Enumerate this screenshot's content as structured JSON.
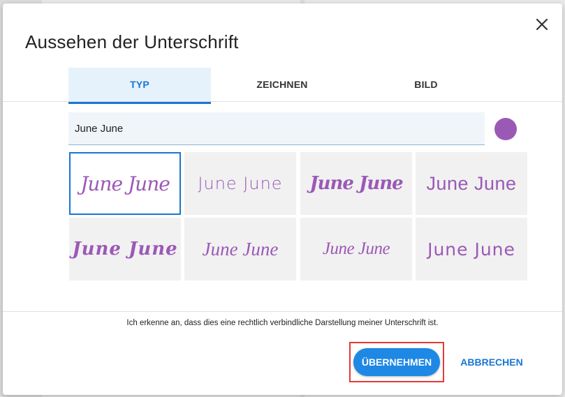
{
  "dialog": {
    "title": "Aussehen der Unterschrift",
    "close_icon": "close-icon"
  },
  "tabs": [
    {
      "label": "TYP",
      "active": true
    },
    {
      "label": "ZEICHNEN",
      "active": false
    },
    {
      "label": "BILD",
      "active": false
    }
  ],
  "name_input": {
    "value": "June June"
  },
  "color": {
    "swatch": "#9b59b6"
  },
  "signature_options": [
    {
      "text": "June June",
      "selected": true
    },
    {
      "text": "June June",
      "selected": false
    },
    {
      "text": "June June",
      "selected": false
    },
    {
      "text": "June June",
      "selected": false
    },
    {
      "text": "June June",
      "selected": false
    },
    {
      "text": "June June",
      "selected": false
    },
    {
      "text": "June June",
      "selected": false
    },
    {
      "text": "June June",
      "selected": false
    }
  ],
  "consent_text": "Ich erkenne an, dass dies eine rechtlich verbindliche Darstellung meiner Unterschrift ist.",
  "actions": {
    "apply_label": "ÜBERNEHMEN",
    "cancel_label": "ABBRECHEN"
  },
  "colors": {
    "accent": "#1976d2",
    "apply_button": "#1e88e5",
    "highlight_border": "#e53935",
    "signature_color": "#9b59b6"
  }
}
